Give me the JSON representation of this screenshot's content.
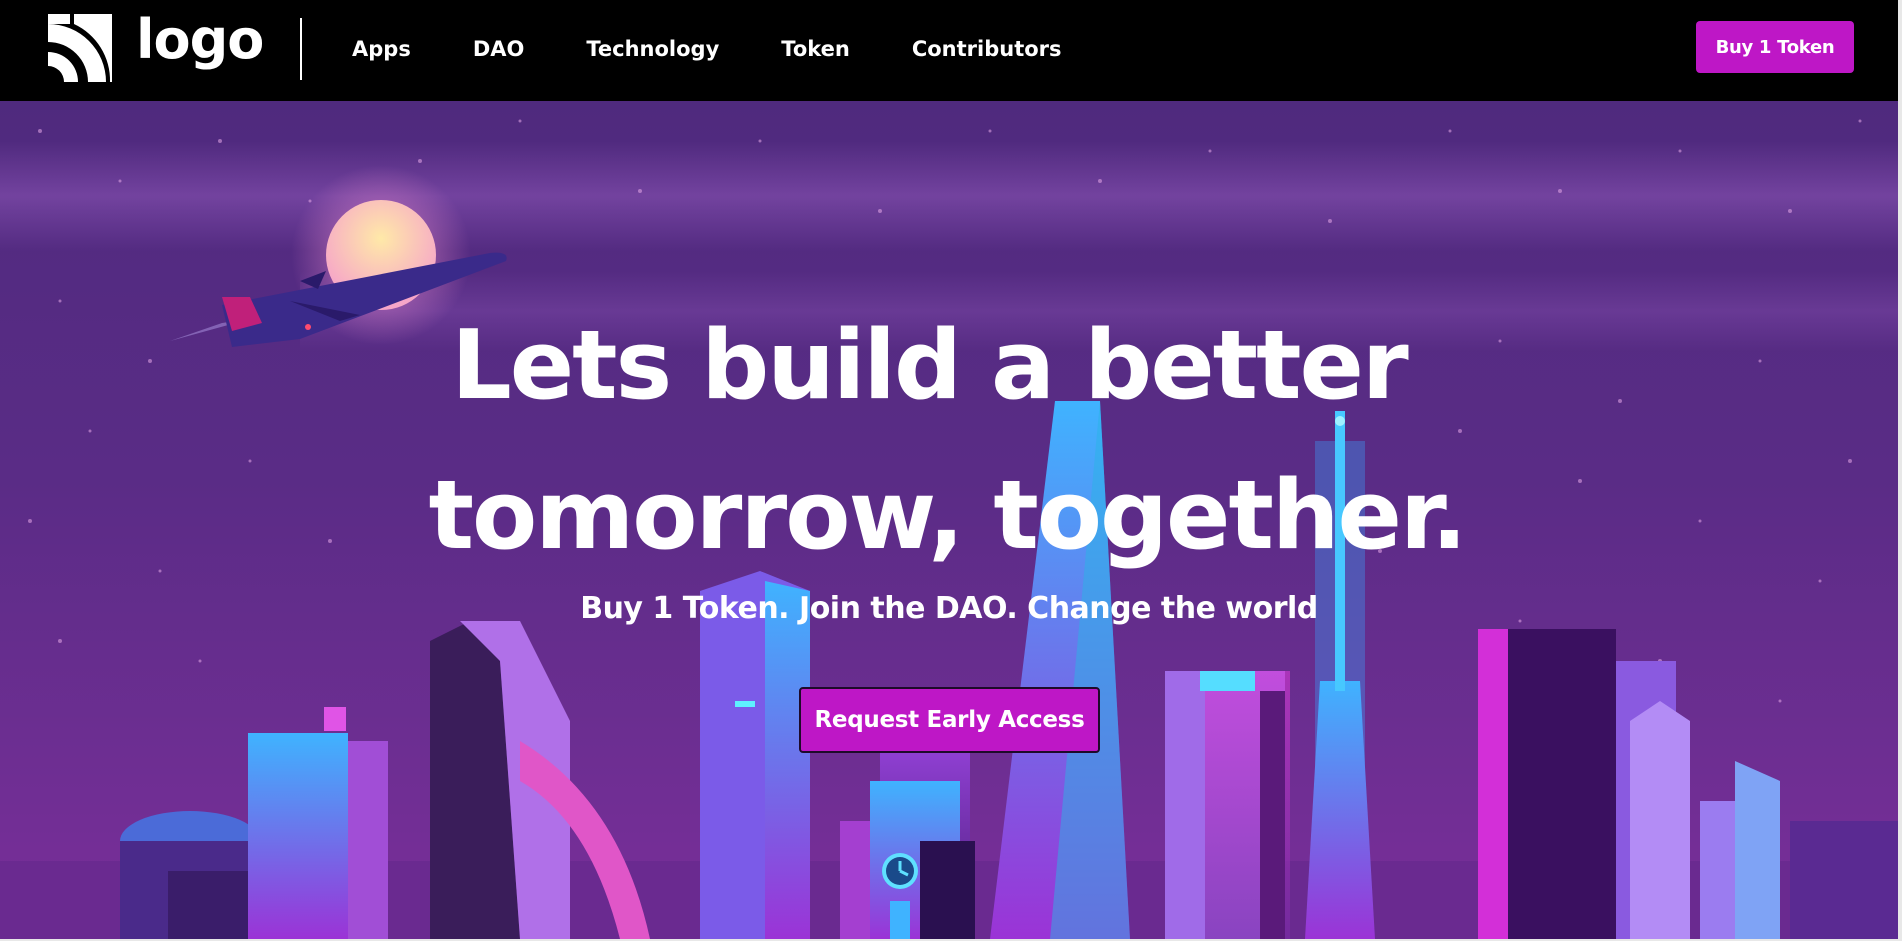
{
  "header": {
    "logo_text": "logo",
    "nav": [
      {
        "label": "Apps"
      },
      {
        "label": "DAO"
      },
      {
        "label": "Technology"
      },
      {
        "label": "Token"
      },
      {
        "label": "Contributors"
      }
    ],
    "buy_button": "Buy 1 Token"
  },
  "hero": {
    "headline_line1": "Lets build a better",
    "headline_line2": "tomorrow, together.",
    "subheadline": "Buy 1 Token. Join the DAO. Change the world",
    "cta_label": "Request Early Access",
    "illustration": "neon city skyline at night with airplane and moon"
  },
  "colors": {
    "accent": "#be17c6",
    "nav_background": "#000000",
    "sky_top": "#4f2a7e",
    "sky_bottom": "#7a2f9a",
    "text": "#ffffff"
  },
  "icons": [
    "logo-mark-icon",
    "airplane-icon",
    "moon-icon",
    "clock-icon"
  ]
}
